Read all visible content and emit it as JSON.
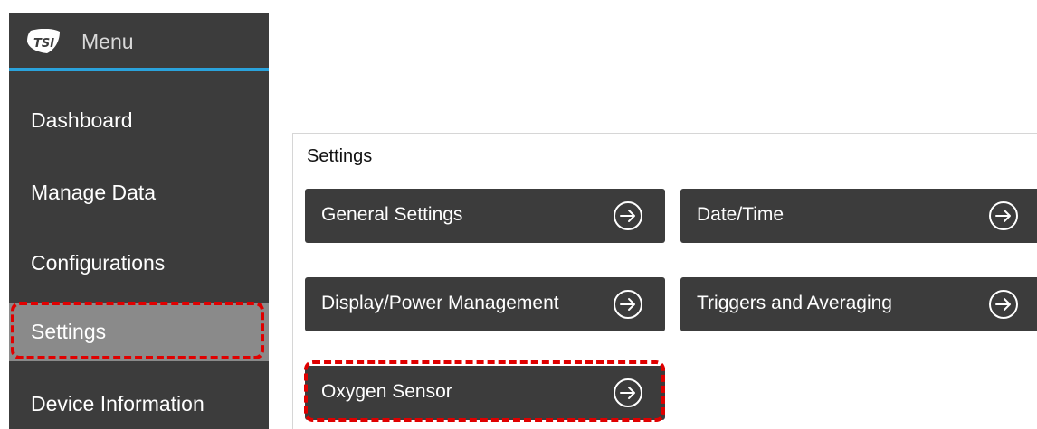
{
  "sidebar": {
    "title": "Menu",
    "items": [
      {
        "label": "Dashboard"
      },
      {
        "label": "Manage Data"
      },
      {
        "label": "Configurations"
      },
      {
        "label": "Settings"
      },
      {
        "label": "Device Information"
      }
    ]
  },
  "settings": {
    "title": "Settings",
    "tiles": [
      {
        "label": "General Settings"
      },
      {
        "label": "Date/Time"
      },
      {
        "label": "Display/Power Management"
      },
      {
        "label": "Triggers and Averaging"
      },
      {
        "label": "Oxygen Sensor"
      }
    ]
  },
  "colors": {
    "sidebar_bg": "#3c3c3c",
    "accent_line": "#2aa3dc",
    "active_item": "#8a8a8a",
    "tile_bg": "#3c3c3c",
    "highlight": "#e00000"
  }
}
